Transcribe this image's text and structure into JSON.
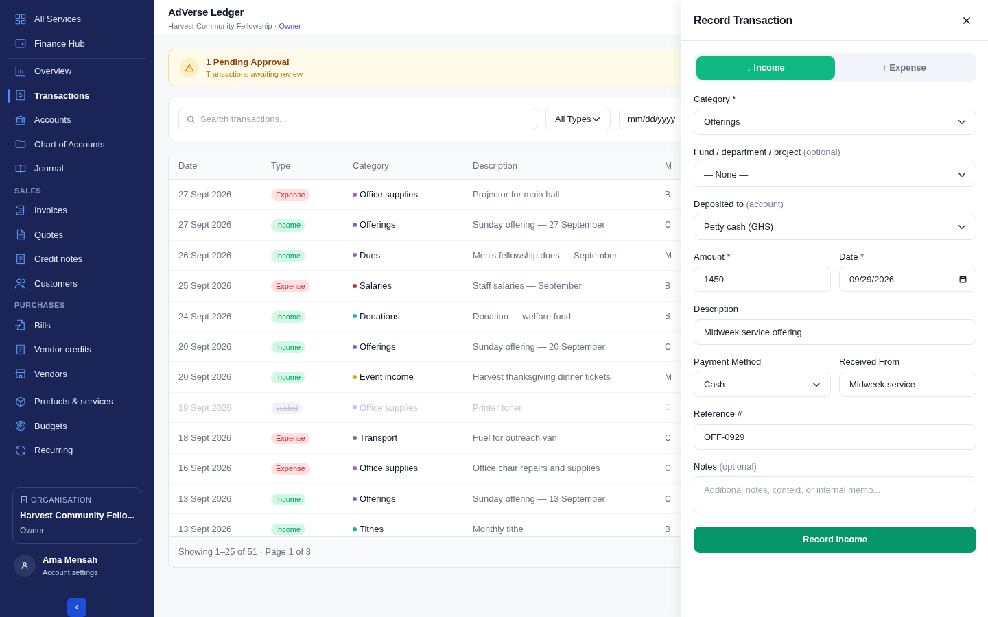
{
  "sidebar": {
    "sections": [
      {
        "divided": false,
        "items": [
          {
            "label": "All Services",
            "selected": false
          },
          {
            "label": "Finance Hub",
            "selected": false
          }
        ]
      },
      {
        "divided": true,
        "items": [
          {
            "label": "Overview",
            "selected": false
          },
          {
            "label": "Transactions",
            "selected": true
          },
          {
            "label": "Accounts",
            "selected": false
          },
          {
            "label": "Chart of Accounts",
            "selected": false
          },
          {
            "label": "Journal",
            "selected": false
          }
        ]
      },
      {
        "divided": false,
        "heading": "SALES",
        "items": [
          {
            "label": "Invoices",
            "selected": false
          },
          {
            "label": "Quotes",
            "selected": false
          },
          {
            "label": "Credit notes",
            "selected": false
          },
          {
            "label": "Customers",
            "selected": false
          }
        ]
      },
      {
        "divided": false,
        "heading": "PURCHASES",
        "items": [
          {
            "label": "Bills",
            "selected": false
          },
          {
            "label": "Vendor credits",
            "selected": false
          },
          {
            "label": "Vendors",
            "selected": false
          }
        ]
      },
      {
        "divided": true,
        "items": [
          {
            "label": "Products & services",
            "selected": false
          },
          {
            "label": "Budgets",
            "selected": false
          },
          {
            "label": "Recurring",
            "selected": false
          }
        ]
      }
    ],
    "organisation": {
      "caption": "ORGANISATION",
      "name": "Harvest Community Fello...",
      "role": "Owner"
    },
    "user": {
      "name": "Ama Mensah",
      "link": "Account settings"
    }
  },
  "header": {
    "title": "AdVerse Ledger",
    "subtitle": "Harvest Community Fellowship ·",
    "role": "Owner"
  },
  "alert": {
    "title": "1 Pending Approval",
    "text": "Transactions awaiting review"
  },
  "filters": {
    "search_placeholder": "Search transactions...",
    "type_filter": "All Types",
    "date_placeholder": "mm/dd/yyyy"
  },
  "table": {
    "columns": [
      "Date",
      "Type",
      "Category",
      "Description",
      "M"
    ],
    "rows": [
      {
        "date": "27 Sept 2026",
        "type": "Expense",
        "kind": "expense",
        "category": "Office supplies",
        "color": "#a855f7",
        "description": "Projector for main hall",
        "column_5": "B"
      },
      {
        "date": "27 Sept 2026",
        "type": "Income",
        "kind": "income",
        "category": "Offerings",
        "color": "#6366f1",
        "description": "Sunday offering — 27 September",
        "column_5": "C"
      },
      {
        "date": "26 Sept 2026",
        "type": "Income",
        "kind": "income",
        "category": "Dues",
        "color": "#8b5cf6",
        "description": "Men's fellowship dues — September",
        "column_5": "M"
      },
      {
        "date": "25 Sept 2026",
        "type": "Expense",
        "kind": "expense",
        "category": "Salaries",
        "color": "#dc2626",
        "description": "Staff salaries — September",
        "column_5": "B"
      },
      {
        "date": "24 Sept 2026",
        "type": "Income",
        "kind": "income",
        "category": "Donations",
        "color": "#14b8a6",
        "description": "Donation — welfare fund",
        "column_5": "B"
      },
      {
        "date": "20 Sept 2026",
        "type": "Income",
        "kind": "income",
        "category": "Offerings",
        "color": "#6366f1",
        "description": "Sunday offering — 20 September",
        "column_5": "C"
      },
      {
        "date": "20 Sept 2026",
        "type": "Income",
        "kind": "income",
        "category": "Event income",
        "color": "#f59e0b",
        "description": "Harvest thanksgiving dinner tickets",
        "column_5": "M"
      },
      {
        "date": "19 Sept 2026",
        "type": "voided",
        "kind": "voided",
        "category": "Office supplies",
        "color": "#d8b4fe",
        "description": "Printer toner",
        "column_5": "C"
      },
      {
        "date": "18 Sept 2026",
        "type": "Expense",
        "kind": "expense",
        "category": "Transport",
        "color": "#64748b",
        "description": "Fuel for outreach van",
        "column_5": "C"
      },
      {
        "date": "16 Sept 2026",
        "type": "Expense",
        "kind": "expense",
        "category": "Office supplies",
        "color": "#a855f7",
        "description": "Office chair repairs and supplies",
        "column_5": "C"
      },
      {
        "date": "13 Sept 2026",
        "type": "Income",
        "kind": "income",
        "category": "Offerings",
        "color": "#6366f1",
        "description": "Sunday offering — 13 September",
        "column_5": "C"
      },
      {
        "date": "13 Sept 2026",
        "type": "Income",
        "kind": "income",
        "category": "Tithes",
        "color": "#10b981",
        "description": "Monthly tithe",
        "column_5": "B"
      }
    ],
    "footer": "Showing 1–25 of 51 · Page 1 of 3"
  },
  "drawer": {
    "title": "Record Transaction",
    "tabs": [
      {
        "label": "↓ Income",
        "selected": true
      },
      {
        "label": "↑ Expense",
        "selected": false
      }
    ],
    "rows": [
      [
        {
          "label": "Category *",
          "kind": "select",
          "value": "Offerings"
        }
      ],
      [
        {
          "label": "Fund / department / project",
          "hint": "(optional)",
          "kind": "select",
          "value": "— None —"
        }
      ],
      [
        {
          "label": "Deposited to",
          "hint": "(account)",
          "kind": "select",
          "value": "Petty cash (GHS)"
        }
      ],
      [
        {
          "label": "Amount *",
          "kind": "input",
          "value": "1450"
        },
        {
          "label": "Date *",
          "kind": "date",
          "value": "09/29/2026"
        }
      ],
      [
        {
          "label": "Description",
          "kind": "input",
          "value": "Midweek service offering"
        }
      ],
      [
        {
          "label": "Payment Method",
          "kind": "select",
          "value": "Cash"
        },
        {
          "label": "Received From",
          "kind": "input",
          "value": "Midweek service"
        }
      ],
      [
        {
          "label": "Reference #",
          "kind": "input",
          "value": "OFF-0929"
        }
      ],
      [
        {
          "label": "Notes",
          "hint": "(optional)",
          "kind": "textarea",
          "placeholder": "Additional notes, context, or internal memo..."
        }
      ]
    ],
    "submit": "Record Income"
  }
}
